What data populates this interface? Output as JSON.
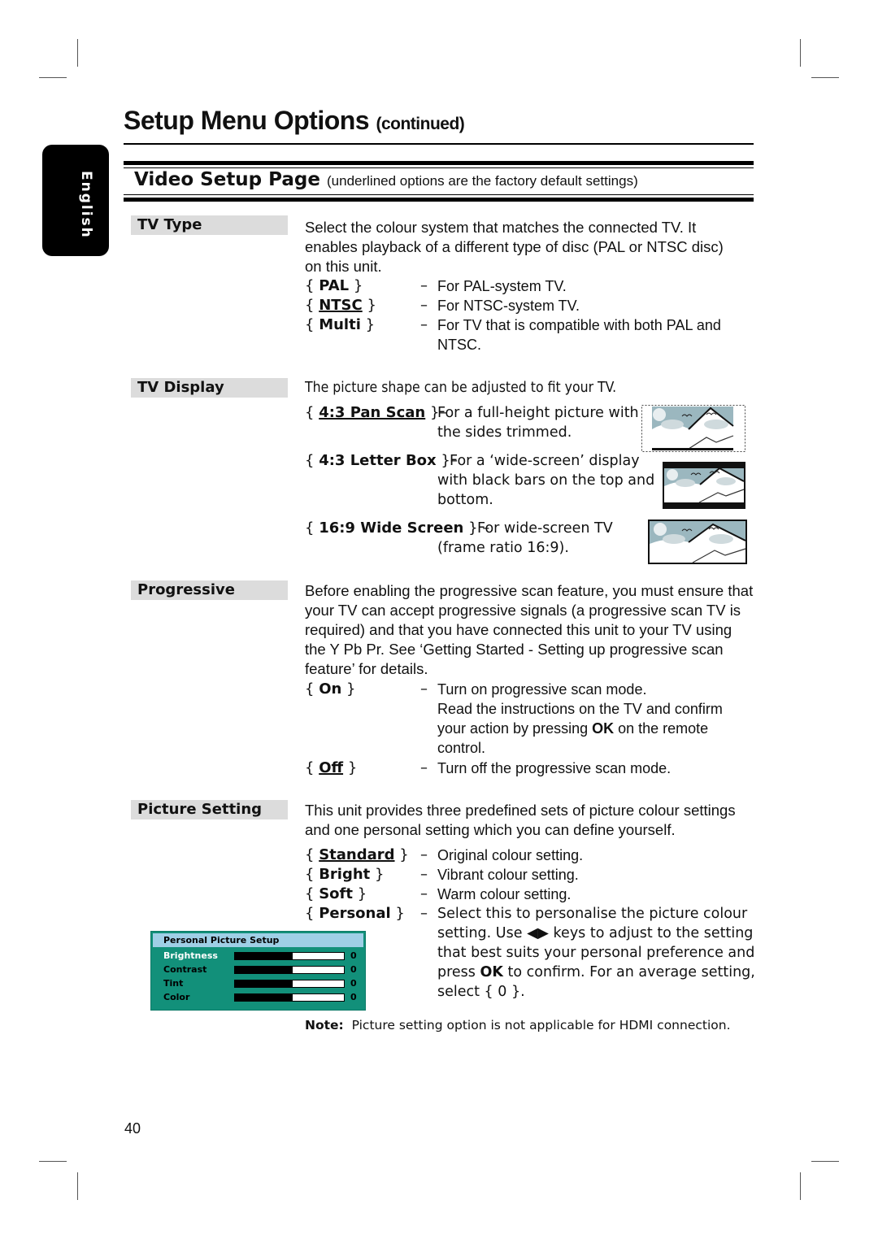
{
  "page": {
    "language_tab": "English",
    "title": "Setup Menu Options",
    "title_suffix": "(continued)",
    "section": {
      "title": "Video Setup Page",
      "note": "(underlined options are the factory default settings)"
    },
    "page_number": "40"
  },
  "tv_type": {
    "label": "TV Type",
    "intro": [
      "Select the colour system that matches the connected TV. It",
      "enables playback of a different type of disc (PAL or NTSC disc)",
      "on this unit."
    ],
    "options": [
      {
        "name": "PAL",
        "default": false,
        "desc": [
          "For PAL-system TV."
        ]
      },
      {
        "name": "NTSC",
        "default": true,
        "desc": [
          "For NTSC-system TV."
        ]
      },
      {
        "name": "Multi",
        "default": false,
        "desc": [
          "For TV that is compatible with both PAL and",
          "NTSC."
        ]
      }
    ]
  },
  "tv_display": {
    "label": "TV Display",
    "intro": "The picture shape can be adjusted to fit your TV.",
    "options": [
      {
        "name": "4:3 Pan Scan",
        "default": true,
        "desc": [
          "For a full-height picture with",
          "the sides trimmed."
        ],
        "icon": "pan-scan-thumbnail"
      },
      {
        "name": "4:3 Letter Box",
        "default": false,
        "desc": [
          "For a ‘wide-screen’ display",
          "with black bars on the top and",
          "bottom."
        ],
        "icon": "letterbox-thumbnail"
      },
      {
        "name": "16:9 Wide Screen",
        "default": false,
        "desc": [
          "For wide-screen TV",
          "(frame ratio 16:9)."
        ],
        "icon": "widescreen-thumbnail"
      }
    ]
  },
  "progressive": {
    "label": "Progressive",
    "intro": [
      "Before enabling the progressive scan feature, you must ensure that",
      "your TV can accept progressive signals (a progressive scan TV is",
      "required) and that you have connected this unit to your TV using",
      "the Y Pb Pr. See ‘Getting Started - Setting up progressive scan",
      "feature’ for details."
    ],
    "options": [
      {
        "name": "On",
        "default": false,
        "desc": [
          "Turn on progressive scan mode.",
          "Read the instructions on the TV and confirm",
          "your action by pressing ",
          "OK",
          " on the remote",
          "control."
        ]
      },
      {
        "name": "Off",
        "default": true,
        "desc": [
          "Turn off the progressive scan mode."
        ]
      }
    ]
  },
  "picture_setting": {
    "label": "Picture Setting",
    "intro": [
      "This unit provides three predefined sets of picture colour settings",
      "and one personal setting which you can define yourself."
    ],
    "options": [
      {
        "name": "Standard",
        "default": true,
        "desc": [
          "Original colour setting."
        ]
      },
      {
        "name": "Bright",
        "default": false,
        "desc": [
          "Vibrant colour setting."
        ]
      },
      {
        "name": "Soft",
        "default": false,
        "desc": [
          "Warm colour setting."
        ]
      },
      {
        "name": "Personal",
        "default": false,
        "desc": [
          "Select this to personalise the picture colour",
          "setting. Use ",
          "◀▶",
          " keys to adjust to the setting",
          "that best suits your personal preference and",
          "press ",
          "OK",
          " to confirm. For an average setting,",
          "select { 0 }."
        ]
      }
    ],
    "panel": {
      "title": "Personal Picture Setup",
      "colors": {
        "background": "#12907a",
        "header": "#9fcfe6"
      },
      "rows": [
        {
          "name": "Brightness",
          "value": "0",
          "level": 0.53,
          "selected": true
        },
        {
          "name": "Contrast",
          "value": "0",
          "level": 0.53,
          "selected": false
        },
        {
          "name": "Tint",
          "value": "0",
          "level": 0.53,
          "selected": false
        },
        {
          "name": "Color",
          "value": "0",
          "level": 0.53,
          "selected": false
        }
      ]
    },
    "note_label": "Note:",
    "note_text": "Picture setting option is not applicable for HDMI connection."
  },
  "brace_open": "{",
  "brace_close": "}",
  "dash": "–"
}
